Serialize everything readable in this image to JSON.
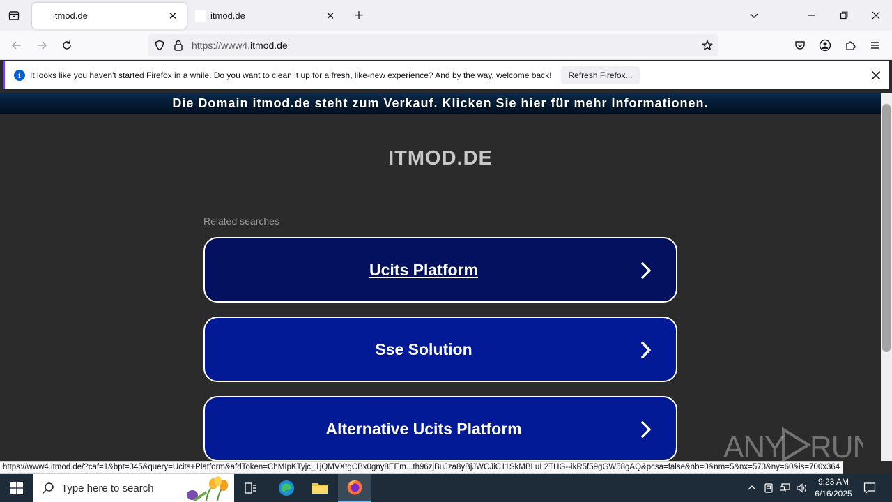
{
  "browser": {
    "tabs": [
      {
        "title": "itmod.de",
        "active": true
      },
      {
        "title": "itmod.de",
        "active": false
      }
    ],
    "url_prefix": "https://www4.",
    "url_domain": "itmod.de",
    "notification": {
      "message": "It looks like you haven't started Firefox in a while. Do you want to clean it up for a fresh, like-new experience? And by the way, welcome back!",
      "button_label": "Refresh Firefox..."
    },
    "status_url": "https://www4.itmod.de/?caf=1&bpt=345&query=Ucits+Platform&afdToken=ChMIpKTyjc_1jQMVXtgCBx0gny8EEm...th96zjBuJza8yBjJWCJiC11SkMBLuL2THG--ikR5f59gGW58gAQ&pcsa=false&nb=0&nm=5&nx=573&ny=60&is=700x364"
  },
  "page": {
    "banner": "Die Domain itmod.de steht zum Verkauf. Klicken Sie hier für mehr Informationen.",
    "site_title": "ITMOD.DE",
    "related_label": "Related searches",
    "searches": [
      {
        "label": "Ucits Platform"
      },
      {
        "label": "Sse Solution"
      },
      {
        "label": "Alternative Ucits Platform"
      }
    ]
  },
  "watermark": "ANY RUN",
  "taskbar": {
    "search_placeholder": "Type here to search",
    "time": "9:23 AM",
    "date": "6/16/2025"
  },
  "colors": {
    "banner": "#0a2a4e",
    "button_selected": "#03115e",
    "button": "#031a97",
    "page_bg": "#2b2b2b",
    "taskbar": "#1e2b38"
  }
}
